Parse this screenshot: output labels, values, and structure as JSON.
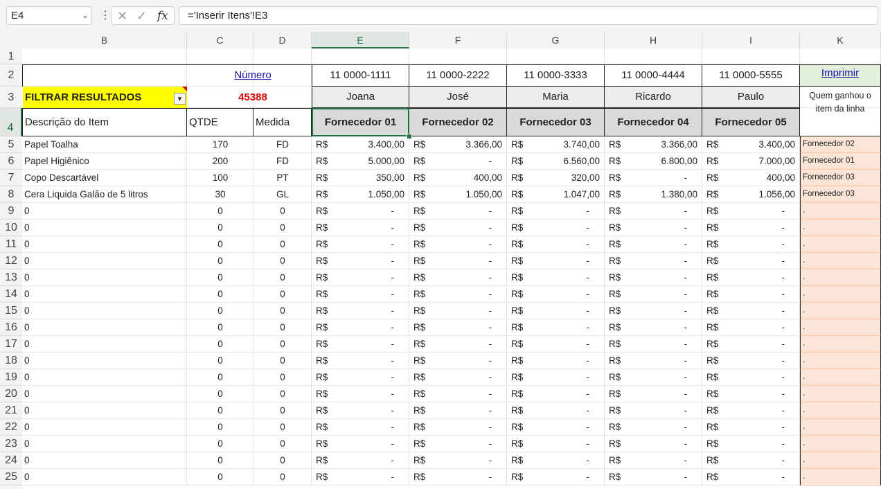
{
  "formula_bar": {
    "name_box": "E4",
    "cancel_icon": "✕",
    "enter_icon": "✓",
    "fx_label": "fx",
    "formula": "='Inserir Itens'!E3"
  },
  "column_headers": [
    "B",
    "C",
    "D",
    "E",
    "F",
    "G",
    "H",
    "I",
    "K"
  ],
  "row_numbers": [
    "1",
    "2",
    "3",
    "4",
    "5",
    "6",
    "7",
    "8",
    "9",
    "10",
    "11",
    "12",
    "13",
    "14",
    "15",
    "16",
    "17",
    "18",
    "19",
    "20",
    "21",
    "22",
    "23",
    "24",
    "25"
  ],
  "selected_column": "E",
  "selected_row": "4",
  "filter": {
    "label": "FILTRAR RESULTADOS",
    "dropdown_icon": "▾"
  },
  "numero": {
    "label": "Número",
    "value": "45388"
  },
  "print": {
    "label": "Imprimir",
    "note": "Quem ganhou o item da linha"
  },
  "suppliers": [
    {
      "phone": "11 0000-1111",
      "name": "Joana",
      "title": "Fornecedor 01"
    },
    {
      "phone": "11 0000-2222",
      "name": "José",
      "title": "Fornecedor 02"
    },
    {
      "phone": "11 0000-3333",
      "name": "Maria",
      "title": "Fornecedor 03"
    },
    {
      "phone": "11 0000-4444",
      "name": "Ricardo",
      "title": "Fornecedor 04"
    },
    {
      "phone": "11 0000-5555",
      "name": "Paulo",
      "title": "Fornecedor 05"
    }
  ],
  "table_headers": {
    "desc": "Descrição do Item",
    "qty": "QTDE",
    "unit": "Medida"
  },
  "currency": "R$",
  "items": [
    {
      "desc": "Papel Toalha",
      "qty": "170",
      "unit": "FD",
      "prices": [
        "3.400,00",
        "3.366,00",
        "3.740,00",
        "3.366,00",
        "3.400,00"
      ],
      "winner": "Fornecedor 02"
    },
    {
      "desc": "Papel Higiênico",
      "qty": "200",
      "unit": "FD",
      "prices": [
        "5.000,00",
        "-",
        "6.560,00",
        "6.800,00",
        "7.000,00"
      ],
      "winner": "Fornecedor 01"
    },
    {
      "desc": "Copo Descartável",
      "qty": "100",
      "unit": "PT",
      "prices": [
        "350,00",
        "400,00",
        "320,00",
        "-",
        "400,00"
      ],
      "winner": "Fornecedor 03"
    },
    {
      "desc": "Cera Liquida Galão de 5 litros",
      "qty": "30",
      "unit": "GL",
      "prices": [
        "1.050,00",
        "1.050,00",
        "1.047,00",
        "1.380,00",
        "1.056,00"
      ],
      "winner": "Fornecedor 03"
    },
    {
      "desc": "0",
      "qty": "0",
      "unit": "0",
      "prices": [
        "-",
        "-",
        "-",
        "-",
        "-"
      ],
      "winner": "."
    },
    {
      "desc": "0",
      "qty": "0",
      "unit": "0",
      "prices": [
        "-",
        "-",
        "-",
        "-",
        "-"
      ],
      "winner": "."
    },
    {
      "desc": "0",
      "qty": "0",
      "unit": "0",
      "prices": [
        "-",
        "-",
        "-",
        "-",
        "-"
      ],
      "winner": "."
    },
    {
      "desc": "0",
      "qty": "0",
      "unit": "0",
      "prices": [
        "-",
        "-",
        "-",
        "-",
        "-"
      ],
      "winner": "."
    },
    {
      "desc": "0",
      "qty": "0",
      "unit": "0",
      "prices": [
        "-",
        "-",
        "-",
        "-",
        "-"
      ],
      "winner": "."
    },
    {
      "desc": "0",
      "qty": "0",
      "unit": "0",
      "prices": [
        "-",
        "-",
        "-",
        "-",
        "-"
      ],
      "winner": "."
    },
    {
      "desc": "0",
      "qty": "0",
      "unit": "0",
      "prices": [
        "-",
        "-",
        "-",
        "-",
        "-"
      ],
      "winner": "."
    },
    {
      "desc": "0",
      "qty": "0",
      "unit": "0",
      "prices": [
        "-",
        "-",
        "-",
        "-",
        "-"
      ],
      "winner": "."
    },
    {
      "desc": "0",
      "qty": "0",
      "unit": "0",
      "prices": [
        "-",
        "-",
        "-",
        "-",
        "-"
      ],
      "winner": "."
    },
    {
      "desc": "0",
      "qty": "0",
      "unit": "0",
      "prices": [
        "-",
        "-",
        "-",
        "-",
        "-"
      ],
      "winner": "."
    },
    {
      "desc": "0",
      "qty": "0",
      "unit": "0",
      "prices": [
        "-",
        "-",
        "-",
        "-",
        "-"
      ],
      "winner": "."
    },
    {
      "desc": "0",
      "qty": "0",
      "unit": "0",
      "prices": [
        "-",
        "-",
        "-",
        "-",
        "-"
      ],
      "winner": "."
    },
    {
      "desc": "0",
      "qty": "0",
      "unit": "0",
      "prices": [
        "-",
        "-",
        "-",
        "-",
        "-"
      ],
      "winner": "."
    },
    {
      "desc": "0",
      "qty": "0",
      "unit": "0",
      "prices": [
        "-",
        "-",
        "-",
        "-",
        "-"
      ],
      "winner": "."
    },
    {
      "desc": "0",
      "qty": "0",
      "unit": "0",
      "prices": [
        "-",
        "-",
        "-",
        "-",
        "-"
      ],
      "winner": "."
    },
    {
      "desc": "0",
      "qty": "0",
      "unit": "0",
      "prices": [
        "-",
        "-",
        "-",
        "-",
        "-"
      ],
      "winner": "."
    },
    {
      "desc": "0",
      "qty": "0",
      "unit": "0",
      "prices": [
        "-",
        "-",
        "-",
        "-",
        "-"
      ],
      "winner": "."
    }
  ],
  "colors": {
    "filter_bg": "#ffff00",
    "numero_value": "#e00000",
    "winner_bg": "#fce4d6",
    "selection": "#217346"
  }
}
